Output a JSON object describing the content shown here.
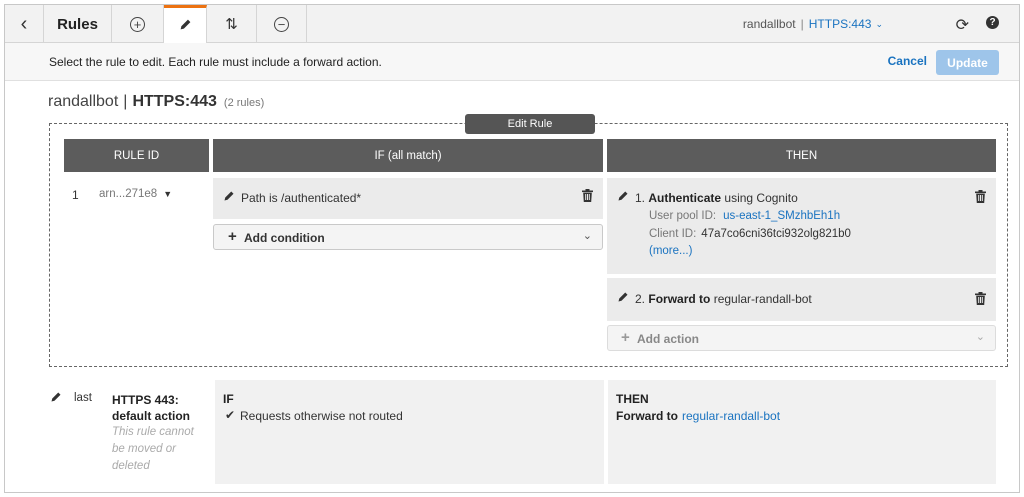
{
  "topbar": {
    "back_icon": "chevron-left-icon",
    "title": "Rules",
    "add_icon": "plus-circle-icon",
    "edit_icon": "pencil-icon",
    "reorder_icon": "reorder-icon",
    "remove_icon": "minus-circle-icon",
    "load_balancer": "randallbot",
    "separator": "|",
    "listener": "HTTPS:443",
    "refresh_icon": "refresh-icon",
    "help_icon": "help-icon",
    "active_tab_color": "#ec7211"
  },
  "instructions": {
    "text": "Select the rule to edit. Each rule must include a forward action.",
    "cancel_label": "Cancel",
    "update_label": "Update"
  },
  "heading": {
    "name": "randallbot",
    "separator": "|",
    "listener": "HTTPS:443",
    "count": "(2 rules)"
  },
  "edit_rule": {
    "tag_label": "Edit Rule",
    "columns": {
      "rule_id": "RULE ID",
      "if": "IF (all match)",
      "then": "THEN"
    },
    "rule": {
      "number": "1",
      "arn": "arn...271e8",
      "conditions": [
        {
          "text": "Path is /authenticated*"
        }
      ],
      "add_condition_label": "Add condition",
      "actions": [
        {
          "index": "1.",
          "action_bold": "Authenticate",
          "action_rest": "using Cognito",
          "user_pool_label": "User pool ID:",
          "user_pool_value": "us-east-1_SMzhbEh1h",
          "client_label": "Client ID:",
          "client_value": "47a7co6cni36tci932olg821b0",
          "more_label": "(more...)"
        },
        {
          "index": "2.",
          "action_bold": "Forward to",
          "target": "regular-randall-bot"
        }
      ],
      "add_action_label": "Add action"
    }
  },
  "default_rule": {
    "number": "last",
    "name": "HTTPS 443: default action",
    "note": "This rule cannot be moved or deleted",
    "if_header": "IF",
    "if_condition": "Requests otherwise not routed",
    "then_header": "THEN",
    "then_action": "Forward to",
    "then_target": "regular-randall-bot"
  }
}
